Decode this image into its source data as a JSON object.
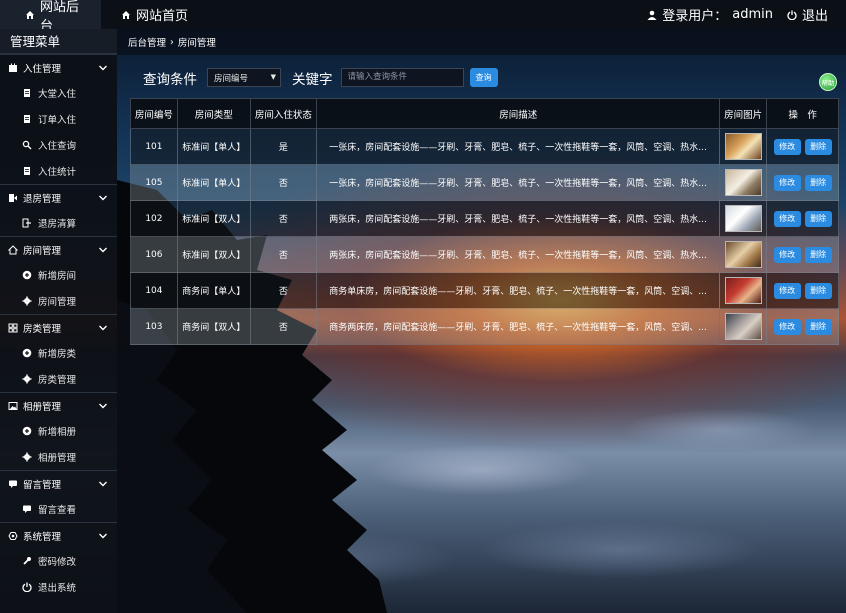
{
  "topbar": {
    "admin_label": "网站后台",
    "home_label": "网站首页",
    "login_label": "登录用户：",
    "username": "admin",
    "logout_label": "退出"
  },
  "sidebar": {
    "title": "管理菜单",
    "groups": [
      {
        "label": "入住管理",
        "icon": "checkin-icon",
        "items": [
          {
            "label": "大堂入住",
            "icon": "document-icon"
          },
          {
            "label": "订单入住",
            "icon": "document-icon"
          },
          {
            "label": "入住查询",
            "icon": "search-icon"
          },
          {
            "label": "入住统计",
            "icon": "document-icon"
          }
        ]
      },
      {
        "label": "退房管理",
        "icon": "checkout-icon",
        "items": [
          {
            "label": "退房清算",
            "icon": "logout-icon"
          }
        ]
      },
      {
        "label": "房间管理",
        "icon": "home-icon",
        "items": [
          {
            "label": "新增房间",
            "icon": "plus-circle-icon"
          },
          {
            "label": "房间管理",
            "icon": "gear-icon"
          }
        ]
      },
      {
        "label": "房类管理",
        "icon": "grid-icon",
        "items": [
          {
            "label": "新增房类",
            "icon": "plus-circle-icon"
          },
          {
            "label": "房类管理",
            "icon": "gear-icon"
          }
        ]
      },
      {
        "label": "相册管理",
        "icon": "image-icon",
        "items": [
          {
            "label": "新增相册",
            "icon": "plus-circle-icon"
          },
          {
            "label": "相册管理",
            "icon": "gear-icon"
          }
        ]
      },
      {
        "label": "留言管理",
        "icon": "comment-icon",
        "items": [
          {
            "label": "留言查看",
            "icon": "comment-icon"
          }
        ]
      },
      {
        "label": "系统管理",
        "icon": "settings-icon",
        "items": [
          {
            "label": "密码修改",
            "icon": "wrench-icon"
          },
          {
            "label": "退出系统",
            "icon": "power-icon"
          }
        ]
      }
    ]
  },
  "breadcrumb": {
    "root": "后台管理",
    "sep": "›",
    "current": "房间管理"
  },
  "search": {
    "condition_label": "查询条件",
    "select_value": "房间编号",
    "keyword_label": "关键字",
    "placeholder": "请输入查询条件",
    "button": "查询"
  },
  "badge": "帮助",
  "table": {
    "headers": [
      "房间编号",
      "房间类型",
      "房间入住状态",
      "房间描述",
      "房间图片",
      "操　作"
    ],
    "edit_label": "修改",
    "delete_label": "删除",
    "rows": [
      {
        "no": "101",
        "type": "标准间【单人】",
        "status": "是",
        "desc": "一张床，房间配套设施——牙刷、牙膏、肥皂、梳子、一次性拖鞋等一套，风筒、空调、热水...",
        "img": "room-photo-icon"
      },
      {
        "no": "105",
        "type": "标准间【单人】",
        "status": "否",
        "desc": "一张床，房间配套设施——牙刷、牙膏、肥皂、梳子、一次性拖鞋等一套，风筒、空调、热水...",
        "img": "room-photo-icon"
      },
      {
        "no": "102",
        "type": "标准间【双人】",
        "status": "否",
        "desc": "两张床，房间配套设施——牙刷、牙膏、肥皂、梳子、一次性拖鞋等一套，风筒、空调、热水...",
        "img": "room-photo-icon"
      },
      {
        "no": "106",
        "type": "标准间【双人】",
        "status": "否",
        "desc": "两张床，房间配套设施——牙刷、牙膏、肥皂、梳子、一次性拖鞋等一套，风筒、空调、热水...",
        "img": "room-photo-icon"
      },
      {
        "no": "104",
        "type": "商务间【单人】",
        "status": "否",
        "desc": "商务单床房，房间配套设施——牙刷、牙膏、肥皂、梳子、一次性拖鞋等一套，风筒、空调、...",
        "img": "room-photo-icon"
      },
      {
        "no": "103",
        "type": "商务间【双人】",
        "status": "否",
        "desc": "商务两床房，房间配套设施——牙刷、牙膏、肥皂、梳子、一次性拖鞋等一套，风筒、空调、...",
        "img": "room-photo-icon"
      }
    ]
  },
  "colors": {
    "accent": "#2b8be0",
    "topbar": "#0b0f16",
    "sidebar": "#0c1016"
  }
}
